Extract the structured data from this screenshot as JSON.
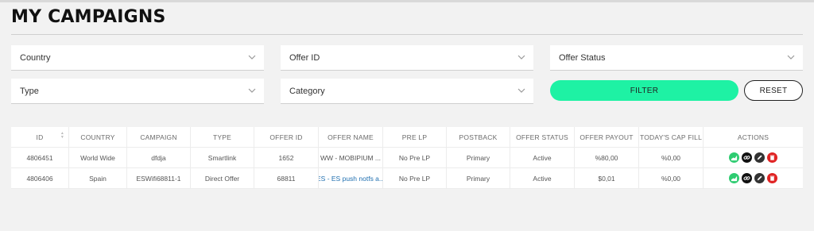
{
  "page": {
    "title": "MY CAMPAIGNS"
  },
  "filters": {
    "country": "Country",
    "offer_id": "Offer ID",
    "offer_status": "Offer Status",
    "type": "Type",
    "category": "Category",
    "filter_label": "FILTER",
    "reset_label": "RESET",
    "filter_color": "#1ef2a4"
  },
  "table": {
    "headers": [
      "ID",
      "COUNTRY",
      "CAMPAIGN",
      "TYPE",
      "OFFER ID",
      "OFFER NAME",
      "PRE LP",
      "POSTBACK",
      "OFFER STATUS",
      "OFFER PAYOUT",
      "TODAY'S CAP FILL",
      "ACTIONS"
    ],
    "rows": [
      {
        "id": "4806451",
        "country": "World Wide",
        "campaign": "dfdja",
        "type": "Smartlink",
        "offer_id": "1652",
        "offer_name": "WW - MOBIPIUM ...",
        "pre_lp": "No Pre LP",
        "postback": "Primary",
        "offer_status": "Active",
        "offer_payout": "%80,00",
        "cap_fill": "%0,00"
      },
      {
        "id": "4806406",
        "country": "Spain",
        "campaign": "ESWifi68811-1",
        "type": "Direct Offer",
        "offer_id": "68811",
        "offer_name": "ES - ES push notfs a...",
        "pre_lp": "No Pre LP",
        "postback": "Primary",
        "offer_status": "Active",
        "offer_payout": "$0,01",
        "cap_fill": "%0,00"
      }
    ],
    "action_icons": [
      "stats-icon",
      "link-icon",
      "edit-icon",
      "delete-icon"
    ],
    "action_colors": {
      "stats": "#2ecc71",
      "link": "#111111",
      "edit": "#333333",
      "delete": "#e02424"
    }
  }
}
